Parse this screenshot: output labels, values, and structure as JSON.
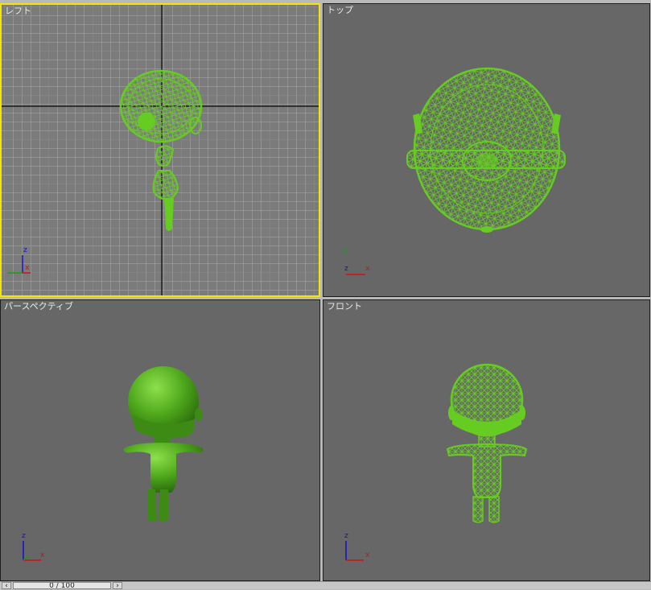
{
  "viewports": {
    "left": {
      "label": "レフト"
    },
    "top": {
      "label": "トップ"
    },
    "perspective": {
      "label": "パースペクティブ"
    },
    "front": {
      "label": "フロント"
    }
  },
  "axes": {
    "z": "z",
    "x": "x",
    "y": "y"
  },
  "colors": {
    "active_border": "#f4e600",
    "mesh_green": "#66cc22",
    "viewport_bg": "#676767",
    "axis_x": "#d01010",
    "axis_y": "#10a010",
    "axis_z": "#1010c8"
  },
  "timeline": {
    "text": "0 / 100",
    "prev_icon": "chevron-left-icon",
    "next_icon": "chevron-right-icon"
  }
}
